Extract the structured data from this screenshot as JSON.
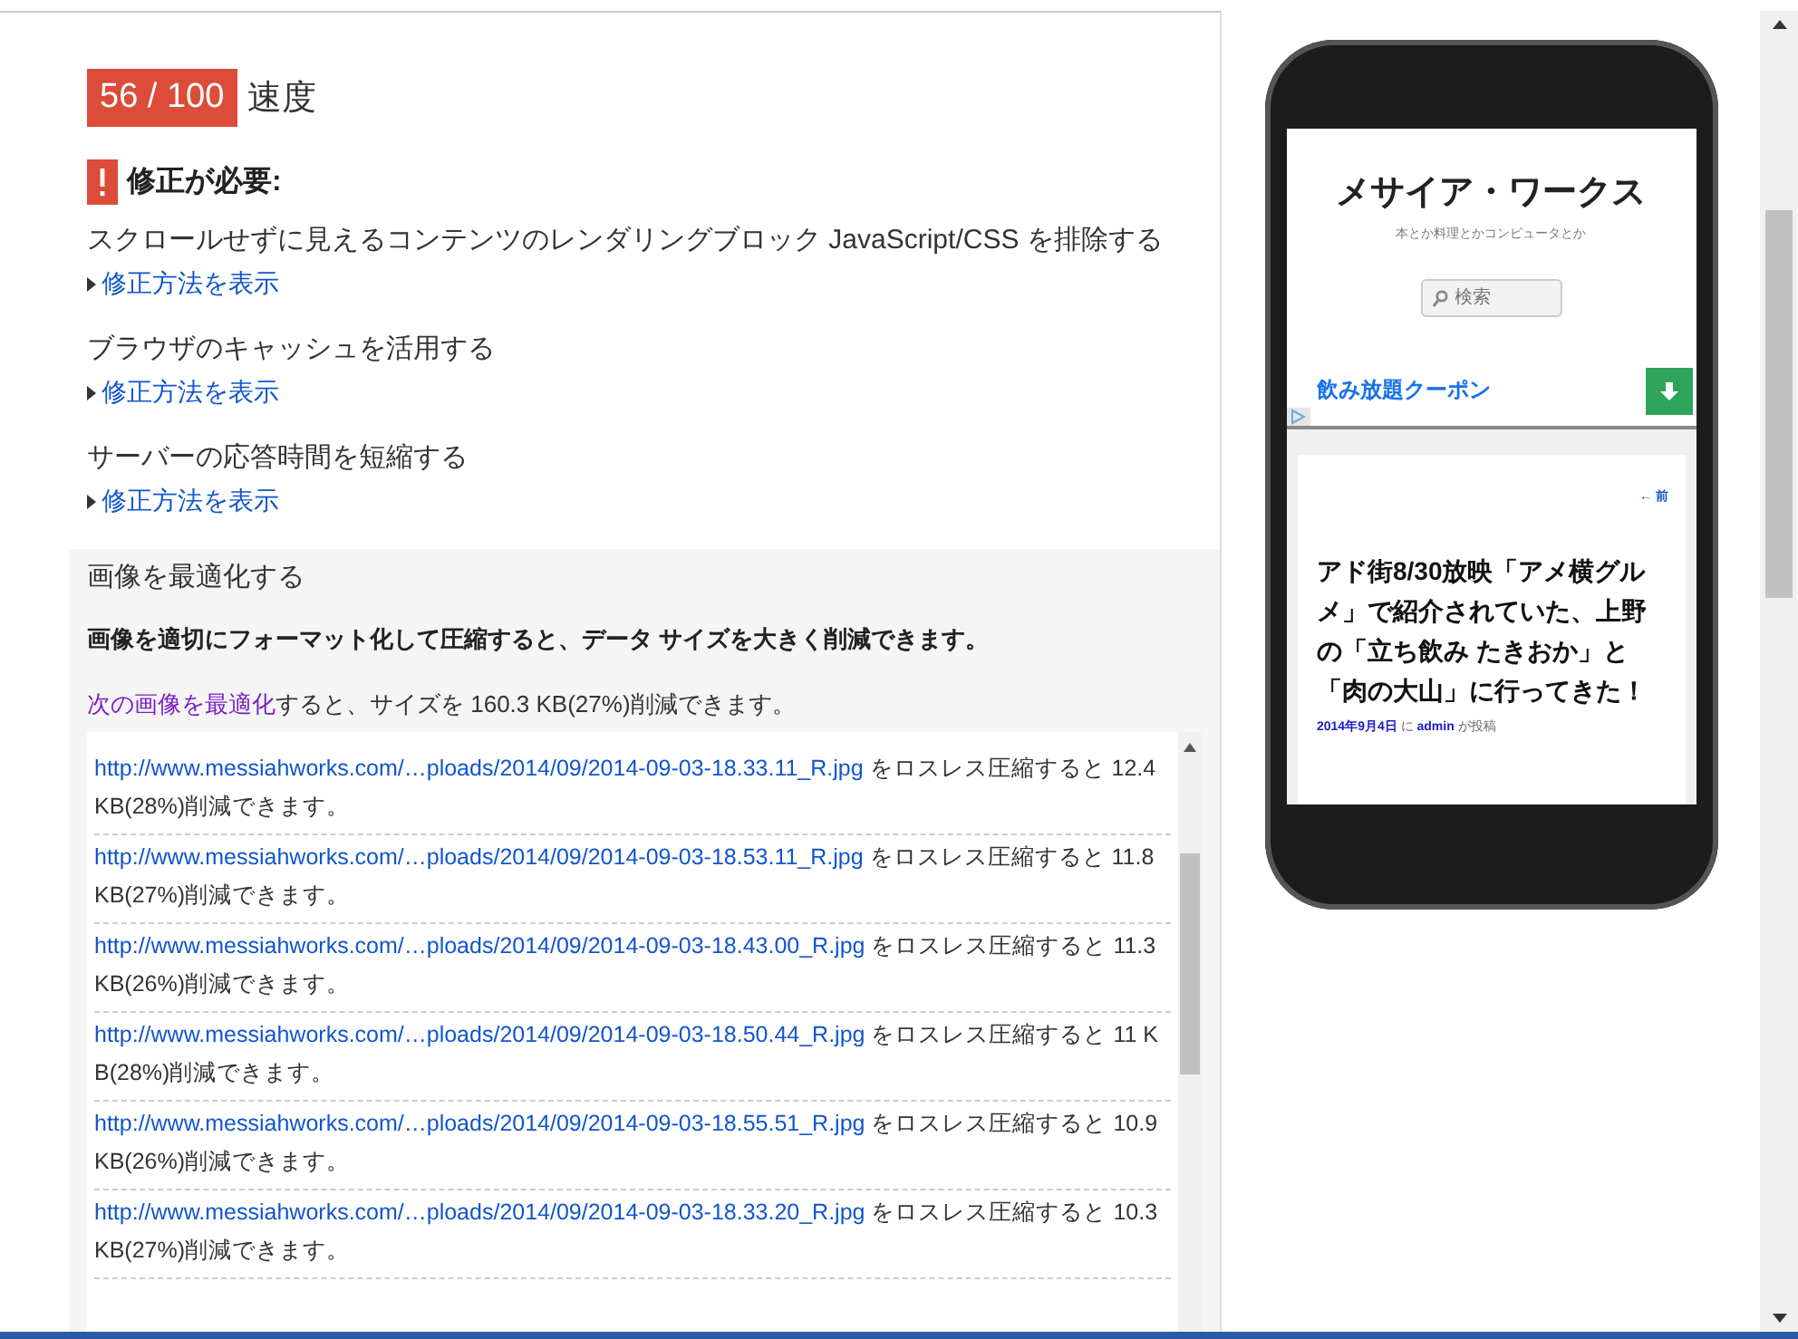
{
  "score": {
    "value": "56 / 100",
    "label": "速度"
  },
  "should_fix": {
    "title": "修正が必要:"
  },
  "rules": [
    {
      "title": "スクロールせずに見えるコンテンツのレンダリングブロック JavaScript/CSS を排除する",
      "link": "修正方法を表示"
    },
    {
      "title": "ブラウザのキャッシュを活用する",
      "link": "修正方法を表示"
    },
    {
      "title": "サーバーの応答時間を短縮する",
      "link": "修正方法を表示"
    }
  ],
  "expanded_rule": {
    "title": "画像を最適化する",
    "description": "画像を適切にフォーマット化して圧縮すると、データ サイズを大きく削減できます。",
    "summary_link": "次の画像を最適化",
    "summary_text": "すると、サイズを 160.3 KB(27%)削減できます。",
    "items": [
      {
        "url": "http://www.messiahworks.com/…ploads/2014/09/2014-09-03-18.33.11_R.jpg",
        "text": " をロスレス圧縮すると 12.4 KB(28%)削減できます。"
      },
      {
        "url": "http://www.messiahworks.com/…ploads/2014/09/2014-09-03-18.53.11_R.jpg",
        "text": " をロスレス圧縮すると 11.8 KB(27%)削減できます。"
      },
      {
        "url": "http://www.messiahworks.com/…ploads/2014/09/2014-09-03-18.43.00_R.jpg",
        "text": " をロスレス圧縮すると 11.3 KB(26%)削減できます。"
      },
      {
        "url": "http://www.messiahworks.com/…ploads/2014/09/2014-09-03-18.50.44_R.jpg",
        "text": " をロスレス圧縮すると 11 KB(28%)削減できます。"
      },
      {
        "url": "http://www.messiahworks.com/…ploads/2014/09/2014-09-03-18.55.51_R.jpg",
        "text": " をロスレス圧縮すると 10.9 KB(26%)削減できます。"
      },
      {
        "url": "http://www.messiahworks.com/…ploads/2014/09/2014-09-03-18.33.20_R.jpg",
        "text": " をロスレス圧縮すると 10.3 KB(27%)削減できます。"
      }
    ]
  },
  "phone_preview": {
    "site_title": "メサイア・ワークス",
    "tagline": "本とか料理とかコンピュータとか",
    "search": {
      "placeholder": "検索"
    },
    "ad": {
      "title": "飲み放題クーポン"
    },
    "prev_link": "← 前",
    "post_title": "アド街8/30放映「アメ横グルメ」で紹介されていた、上野の「立ち飲み たきおか」と「肉の大山」に行ってきた！",
    "meta": {
      "date": "2014年9月4日",
      "connector": " に ",
      "author": "admin",
      "suffix": " が投稿"
    }
  }
}
